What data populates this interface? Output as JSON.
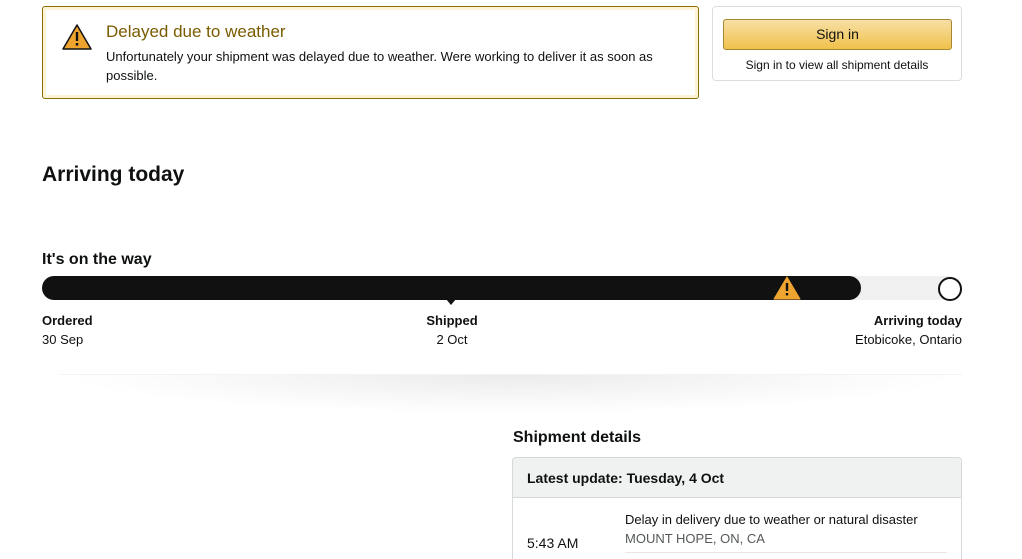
{
  "alert": {
    "title": "Delayed due to weather",
    "message": "Unfortunately your shipment was delayed due to weather. Were working to deliver it as soon as possible.",
    "icon": "warning-icon",
    "color": "#7a5b00"
  },
  "signin": {
    "button_label": "Sign in",
    "note": "Sign in to view all shipment details"
  },
  "status_heading": "Arriving today",
  "progress": {
    "heading": "It's on the way",
    "fraction_complete": 0.89,
    "milestones": [
      {
        "label": "Ordered",
        "value": "30 Sep"
      },
      {
        "label": "Shipped",
        "value": "2 Oct"
      },
      {
        "label": "Arriving today",
        "value": "Etobicoke, Ontario"
      }
    ]
  },
  "shipment_details": {
    "heading": "Shipment details",
    "latest_update": "Latest update: Tuesday, 4 Oct",
    "events": [
      {
        "time": "5:43 AM",
        "description": "Delay in delivery due to weather or natural disaster",
        "location": "MOUNT HOPE, ON, CA"
      }
    ]
  }
}
